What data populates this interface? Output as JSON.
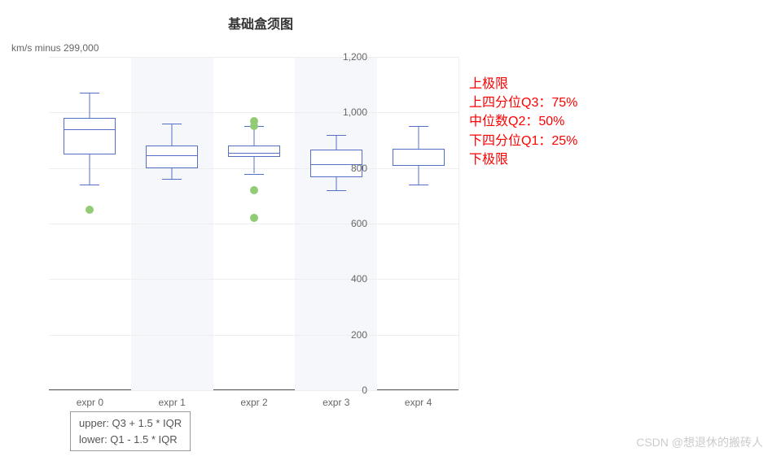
{
  "title": "基础盒须图",
  "ylabel": "km/s minus 299,000",
  "y_ticks": [
    0,
    200,
    400,
    600,
    800,
    1000,
    1200
  ],
  "categories": [
    "expr 0",
    "expr 1",
    "expr 2",
    "expr 3",
    "expr 4"
  ],
  "legend": {
    "upper": "upper: Q3 + 1.5 * IQR",
    "lower": "lower: Q1 - 1.5 * IQR"
  },
  "annotations": {
    "upper_limit": "上极限",
    "q3": "上四分位Q3：75%",
    "median": "中位数Q2：50%",
    "q1": "下四分位Q1：25%",
    "lower_limit": "下极限"
  },
  "watermark": "CSDN @想退休的搬砖人",
  "chart_data": {
    "type": "boxplot",
    "title": "基础盒须图",
    "xlabel": "",
    "ylabel": "km/s minus 299,000",
    "ylim": [
      0,
      1200
    ],
    "categories": [
      "expr 0",
      "expr 1",
      "expr 2",
      "expr 3",
      "expr 4"
    ],
    "series": [
      {
        "name": "expr 0",
        "min": 740,
        "q1": 850,
        "median": 940,
        "q3": 980,
        "max": 1070,
        "outliers": [
          650
        ]
      },
      {
        "name": "expr 1",
        "min": 760,
        "q1": 800,
        "median": 845,
        "q3": 880,
        "max": 960,
        "outliers": []
      },
      {
        "name": "expr 2",
        "min": 780,
        "q1": 840,
        "median": 855,
        "q3": 880,
        "max": 950,
        "outliers": [
          620,
          720,
          970,
          950
        ]
      },
      {
        "name": "expr 3",
        "min": 720,
        "q1": 767,
        "median": 815,
        "q3": 865,
        "max": 920,
        "outliers": []
      },
      {
        "name": "expr 4",
        "min": 740,
        "q1": 807,
        "median": 810,
        "q3": 870,
        "max": 950,
        "outliers": []
      }
    ]
  }
}
